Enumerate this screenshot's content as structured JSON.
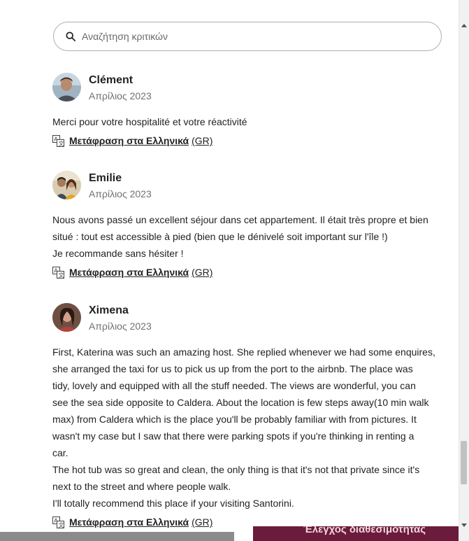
{
  "search": {
    "placeholder": "Αναζήτηση κριτικών"
  },
  "translate": {
    "link": "Μετάφραση στα Ελληνικά",
    "suffix": "(GR)"
  },
  "reviews": [
    {
      "name": "Clément",
      "date": "Απρίλιος 2023",
      "lines": [
        "Merci pour votre hospitalité et votre réactivité"
      ]
    },
    {
      "name": "Emilie",
      "date": "Απρίλιος 2023",
      "lines": [
        "Nous avons passé un excellent séjour dans cet appartement. Il était très propre et bien",
        "situé : tout est accessible à pied (bien que le dénivelé soit important sur l'île !)",
        "Je recommande sans hésiter !"
      ]
    },
    {
      "name": "Ximena",
      "date": "Απρίλιος 2023",
      "lines": [
        "First, Katerina was such an amazing host. She replied whenever we had some enquires,",
        "she arranged the taxi for us to pick us up from the port to the airbnb. The place was",
        "tidy, lovely and equipped with all the stuff needed. The views are wonderful, you can",
        "see the sea side opposite to Caldera. About the location is few steps away(10 min walk",
        "max) from Caldera which is the place you'll be probably familiar with from pictures. It",
        "wasn't my case but I saw that there were parking spots if you're thinking in renting a",
        "car.",
        "The hot tub was so great and clean, the only thing is that it's not that private since it's",
        "next to the street and where people walk.",
        "I'll totally recommend this place if your visiting Santorini."
      ]
    }
  ],
  "background_button": {
    "label": "Έλεγχος διαθεσιμότητας"
  },
  "colors": {
    "text": "#222222",
    "muted": "#717171",
    "border": "#b0b0b0",
    "brand_bg": "#6b1b3b"
  }
}
